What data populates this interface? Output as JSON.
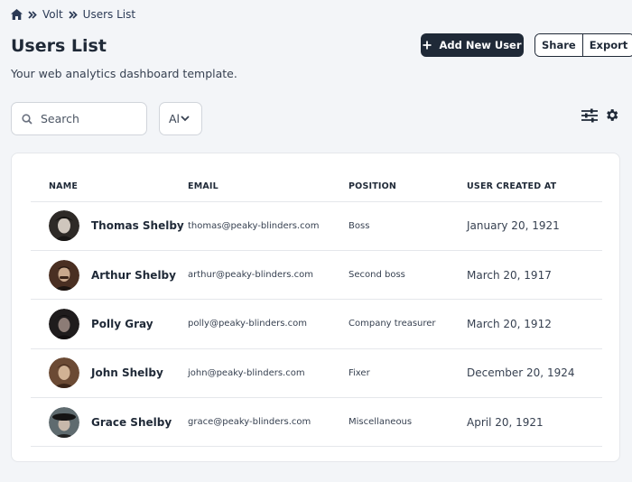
{
  "breadcrumb": {
    "home_icon": "home-icon",
    "link": "Volt",
    "current": "Users List"
  },
  "header": {
    "title": "Users List",
    "subtitle": "Your web analytics dashboard template.",
    "add_button": "Add New User",
    "share_button": "Share",
    "export_button": "Export"
  },
  "filters": {
    "search_placeholder": "Search",
    "select_value": "All"
  },
  "table": {
    "columns": [
      "Name",
      "Email",
      "Position",
      "User Created at"
    ],
    "rows": [
      {
        "name": "Thomas Shelby",
        "email": "thomas@peaky-blinders.com",
        "position": "Boss",
        "created": "January 20, 1921"
      },
      {
        "name": "Arthur Shelby",
        "email": "arthur@peaky-blinders.com",
        "position": "Second boss",
        "created": "March 20, 1917"
      },
      {
        "name": "Polly Gray",
        "email": "polly@peaky-blinders.com",
        "position": "Company treasurer",
        "created": "March 20, 1912"
      },
      {
        "name": "John Shelby",
        "email": "john@peaky-blinders.com",
        "position": "Fixer",
        "created": "December 20, 1924"
      },
      {
        "name": "Grace Shelby",
        "email": "grace@peaky-blinders.com",
        "position": "Miscellaneous",
        "created": "April 20, 1921"
      }
    ]
  },
  "colors": {
    "primary": "#1f2937",
    "background": "#f3f5f8",
    "card": "#ffffff",
    "border": "#e5e7eb"
  }
}
